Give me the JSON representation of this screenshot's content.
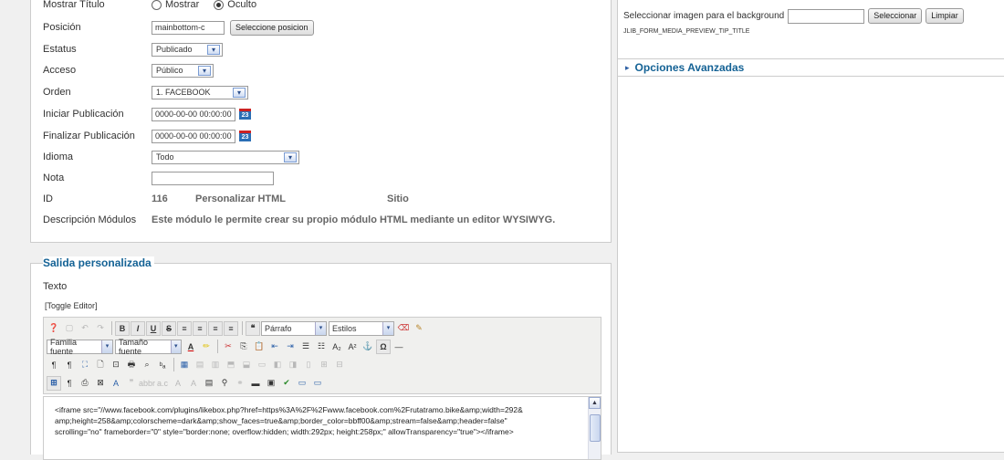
{
  "details": {
    "mostrar_titulo": {
      "label": "Mostrar Título",
      "opt_show": "Mostrar",
      "opt_hide": "Oculto",
      "selected": "Oculto"
    },
    "posicion": {
      "label": "Posición",
      "value": "mainbottom-c",
      "button": "Seleccione posicion"
    },
    "estatus": {
      "label": "Estatus",
      "value": "Publicado"
    },
    "acceso": {
      "label": "Acceso",
      "value": "Público"
    },
    "orden": {
      "label": "Orden",
      "value": "1. FACEBOOK"
    },
    "iniciar": {
      "label": "Iniciar Publicación",
      "value": "0000-00-00 00:00:00"
    },
    "finalizar": {
      "label": "Finalizar Publicación",
      "value": "0000-00-00 00:00:00"
    },
    "idioma": {
      "label": "Idioma",
      "value": "Todo"
    },
    "nota": {
      "label": "Nota",
      "value": ""
    },
    "id": {
      "label": "ID",
      "value": "116",
      "type": "Personalizar HTML",
      "site": "Sitio"
    },
    "descripcion": {
      "label": "Descripción Módulos",
      "value": "Este módulo le permite crear su propio módulo HTML mediante un editor WYSIWYG."
    },
    "calendar_icon_text": "23"
  },
  "right": {
    "bg_label": "Seleccionar imagen para el background",
    "bg_value": "",
    "select_button": "Seleccionar",
    "clear_button": "Limpiar",
    "preview_tip": "JLIB_FORM_MEDIA_PREVIEW_TIP_TITLE",
    "advanced": "Opciones Avanzadas"
  },
  "salida": {
    "legend": "Salida personalizada",
    "texto_label": "Texto",
    "toggle": "[Toggle Editor]",
    "format_select": "Párrafo",
    "styles_select": "Estilos",
    "font_family": "Familia fuente",
    "font_size": "Tamaño fuente",
    "content_line1": "<iframe src=\"//www.facebook.com/plugins/likebox.php?href=https%3A%2F%2Fwww.facebook.com%2Frutatramo.bike&amp;width=292&",
    "content_line2": "amp;height=258&amp;colorscheme=dark&amp;show_faces=true&amp;border_color=bbff00&amp;stream=false&amp;header=false\"",
    "content_line3": "scrolling=\"no\" frameborder=\"0\" style=\"border:none; overflow:hidden; width:292px; height:258px;\" allowTransparency=\"true\"></iframe>"
  },
  "icons": {
    "arrow_down": "▾",
    "arrow_right": "▸",
    "arrow_up": "▲"
  }
}
